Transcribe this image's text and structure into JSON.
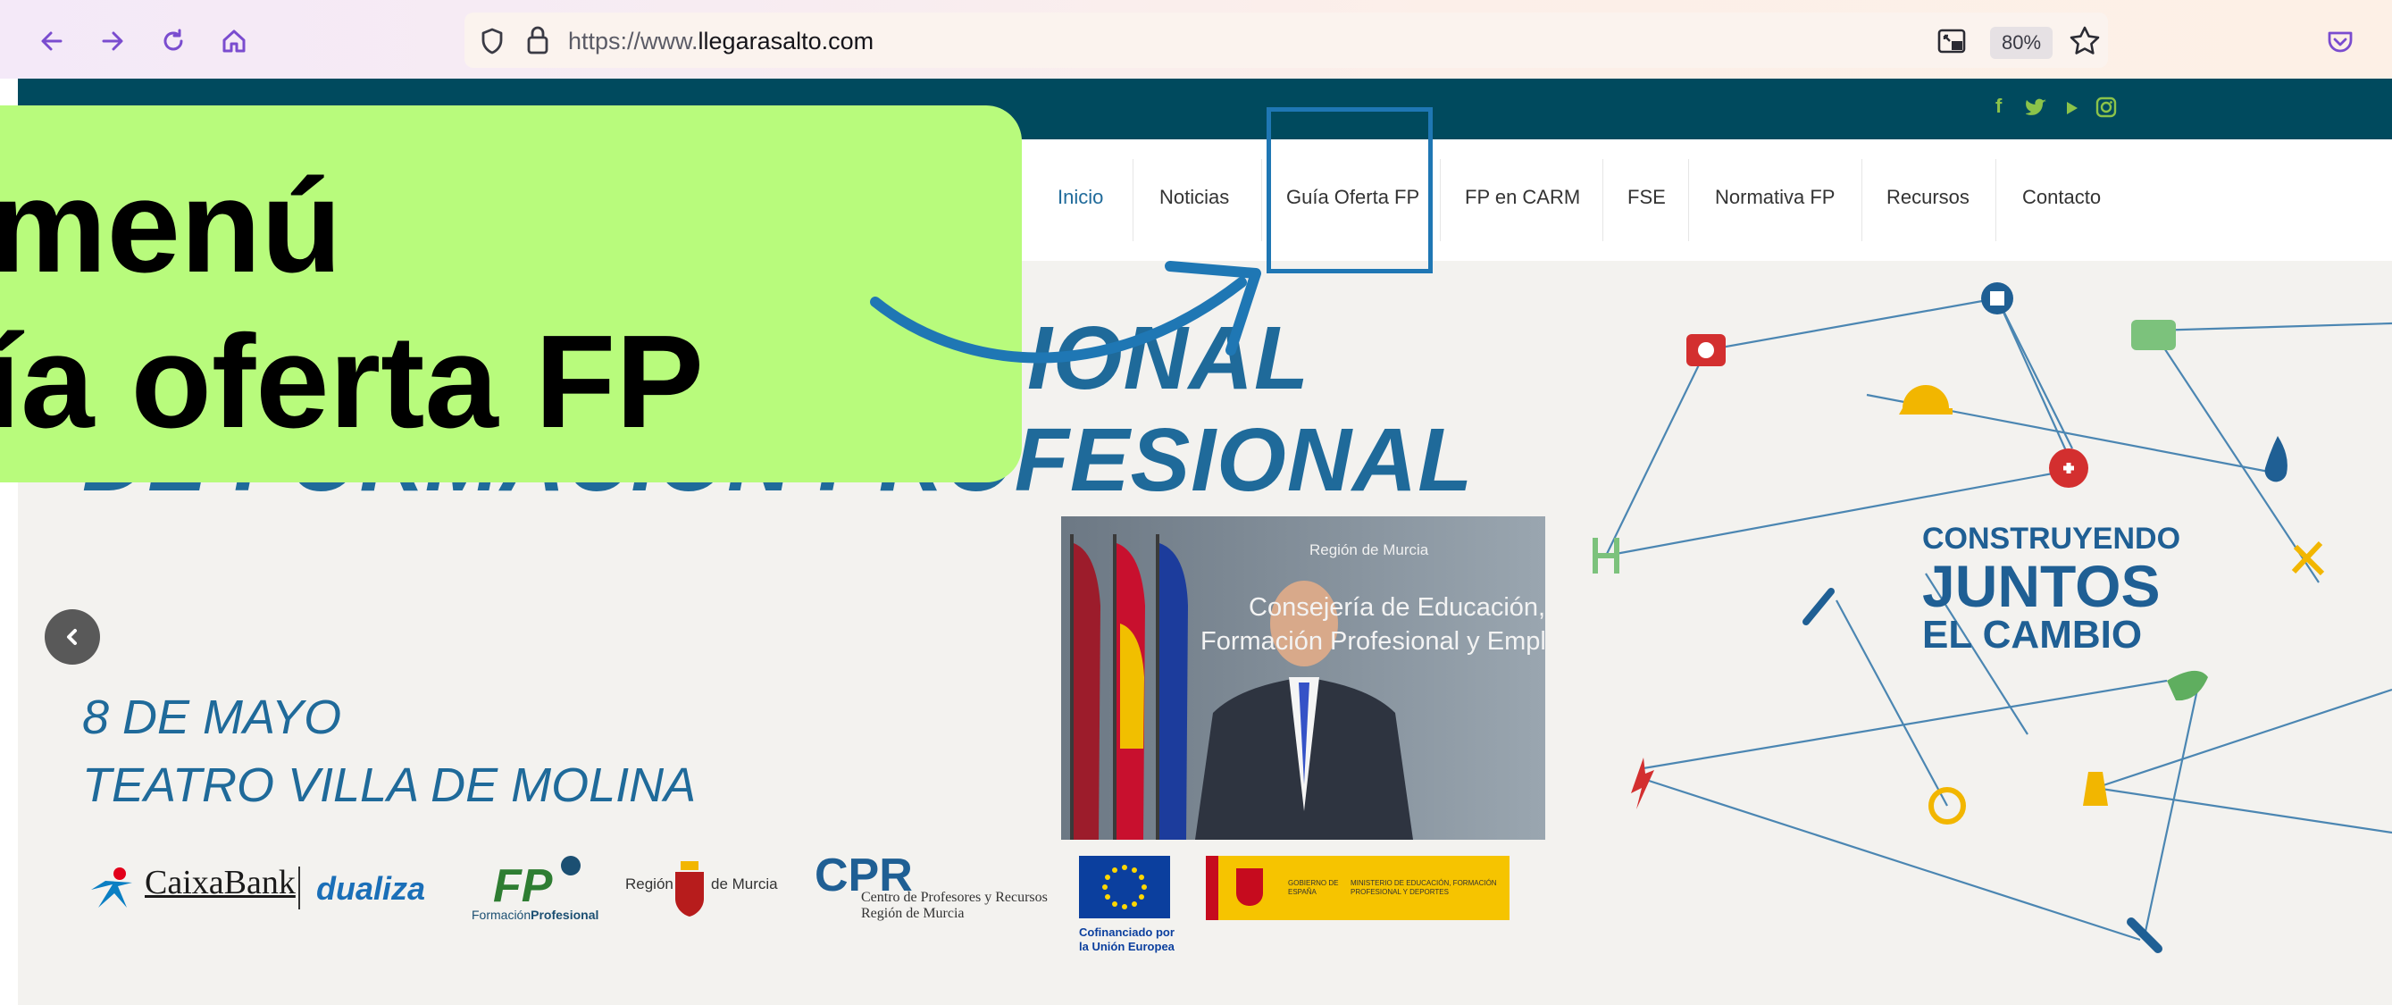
{
  "browser": {
    "url_prefix": "https://www.",
    "url_domain": "llegarasalto.com",
    "zoom": "80%",
    "icons": [
      "back-icon",
      "forward-icon",
      "reload-icon",
      "home-icon",
      "shield-icon",
      "lock-icon",
      "picture-in-picture-icon",
      "star-icon",
      "pocket-icon"
    ]
  },
  "site": {
    "social_icons": [
      "facebook-icon",
      "twitter-icon",
      "youtube-icon",
      "instagram-icon"
    ],
    "nav": [
      {
        "label": "Inicio",
        "active": true
      },
      {
        "label": "Noticias"
      },
      {
        "label": "Guía Oferta FP"
      },
      {
        "label": "FP en CARM"
      },
      {
        "label": "FSE"
      },
      {
        "label": "Normativa FP"
      },
      {
        "label": "Recursos"
      },
      {
        "label": "Contacto"
      }
    ],
    "hero": {
      "title_line1": "IONAL",
      "title_line2": "DE FORMACIÓN PROFESIONAL",
      "date": "8 DE MAYO",
      "venue": "TEATRO VILLA DE MOLINA",
      "photo_caption_line1": "Región de Murcia",
      "photo_caption_line2": "Consejería de Educación,",
      "photo_caption_line3": "Formación Profesional y Empleo",
      "right_line1": "CONSTRUYENDO",
      "right_line2": "JUNTOS",
      "right_line3": "EL CAMBIO"
    },
    "sponsors": {
      "caixabank": "CaixaBank",
      "dualiza": "dualiza",
      "fp_logo": "FP",
      "fp_caption_1": "Formación",
      "fp_caption_2": "Profesional",
      "region_1": "Región",
      "region_2": "de Murcia",
      "cpr": "CPR",
      "cpr_line1": "Centro de Profesores y Recursos",
      "cpr_line2": "Región de Murcia",
      "eu_line1": "Cofinanciado por",
      "eu_line2": "la Unión Europea",
      "gov_1": "GOBIERNO DE ESPAÑA",
      "gov_2": "MINISTERIO DE EDUCACIÓN, FORMACIÓN PROFESIONAL Y DEPORTES"
    }
  },
  "overlay": {
    "line1": "menú",
    "line2": "ía oferta FP"
  },
  "colors": {
    "callout_bg": "#b8fb7c",
    "highlight_border": "#1f77b4",
    "site_dark": "#004a5e",
    "accent_green": "#8bc34a",
    "hero_blue": "#1f6a9a"
  }
}
